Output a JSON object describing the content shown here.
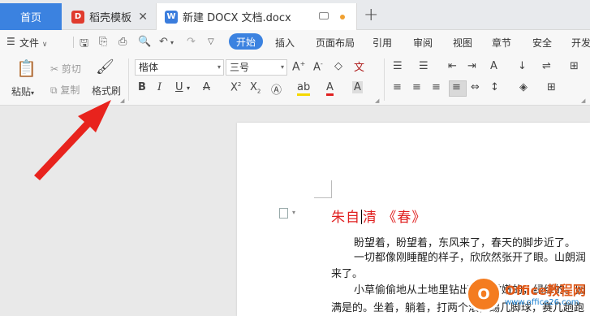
{
  "tabs": {
    "home": "首页",
    "template": "稻壳模板",
    "doc": "新建 DOCX 文档.docx",
    "template_icon_letter": "D",
    "doc_icon_letter": "W",
    "close": "✕",
    "add": "+"
  },
  "menu": {
    "file": "文件",
    "items": [
      "开始",
      "插入",
      "页面布局",
      "引用",
      "审阅",
      "视图",
      "章节",
      "安全",
      "开发"
    ]
  },
  "ribbon": {
    "paste": "粘贴",
    "cut": "剪切",
    "copy": "复制",
    "format_painter": "格式刷",
    "font_name": "楷体",
    "font_size": "三号"
  },
  "document": {
    "title_part1": "朱自",
    "title_part2": "清 《春》",
    "lines": [
      "盼望着，盼望着，东风来了，春天的脚步近了。",
      "一切都像刚睡醒的样子，欣欣然张开了眼。山朗润",
      "来了。",
      "小草偷偷地从土地里钻出来，嫩嫩的，绿绿的。园",
      "满是的。坐着，躺着，打两个滚，踢几脚球，赛几趟跑"
    ]
  },
  "watermark": {
    "logo": "O",
    "line1": "Office教程网",
    "line2": "www.office26.com"
  },
  "colors": {
    "accent": "#3b82e0",
    "title_red": "#e02020",
    "arrow": "#e8231d"
  }
}
